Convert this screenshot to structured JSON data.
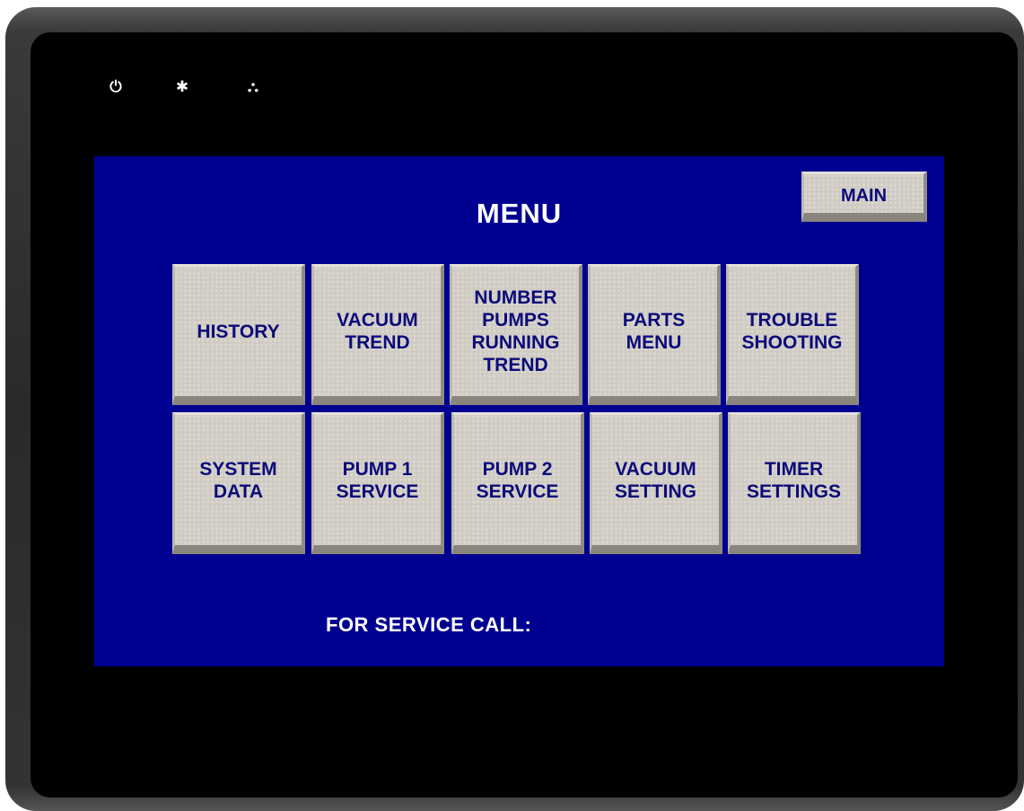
{
  "device": {
    "indicators": [
      "⏻",
      "✱",
      "⛬"
    ]
  },
  "screen": {
    "title": "MENU",
    "main_button": "MAIN",
    "menu_buttons": [
      {
        "label": "HISTORY"
      },
      {
        "label": "VACUUM\nTREND"
      },
      {
        "label": "NUMBER\nPUMPS\nRUNNING\nTREND"
      },
      {
        "label": "PARTS\nMENU"
      },
      {
        "label": "TROUBLE\nSHOOTING"
      },
      {
        "label": "SYSTEM\nDATA"
      },
      {
        "label": "PUMP 1\nSERVICE"
      },
      {
        "label": "PUMP 2\nSERVICE"
      },
      {
        "label": "VACUUM\nSETTING"
      },
      {
        "label": "TIMER\nSETTINGS"
      }
    ],
    "footer": "FOR SERVICE CALL:"
  },
  "colors": {
    "screen_bg": "#000090",
    "button_face": "#cfcbc3",
    "button_text": "#0b0b7a",
    "title_text": "#ffffff"
  }
}
